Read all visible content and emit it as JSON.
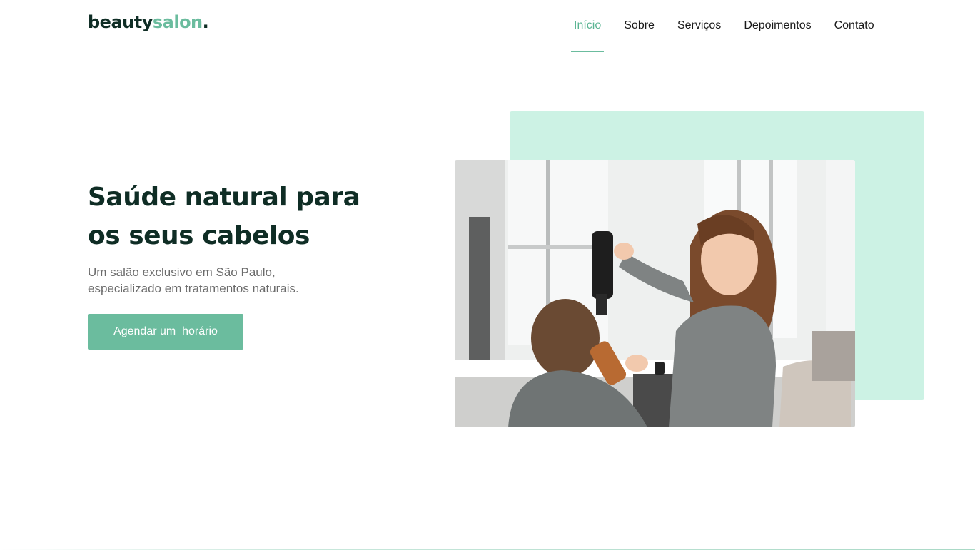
{
  "brand": {
    "name_part1": "beauty",
    "name_part2": "salon",
    "name_dot": "."
  },
  "nav": {
    "items": [
      {
        "label": "Início",
        "active": true
      },
      {
        "label": "Sobre"
      },
      {
        "label": "Serviços"
      },
      {
        "label": "Depoimentos"
      },
      {
        "label": "Contato"
      }
    ]
  },
  "hero": {
    "title": "Saúde natural para os seus cabelos",
    "subtitle": "Um salão exclusivo em São Paulo, especializado em tratamentos naturais.",
    "cta_label": "Agendar um  horário"
  },
  "colors": {
    "accent": "#6bbc9e",
    "accent_light": "#ccf2e4",
    "heading": "#0f2d25",
    "body_text": "#6b6b6b"
  }
}
